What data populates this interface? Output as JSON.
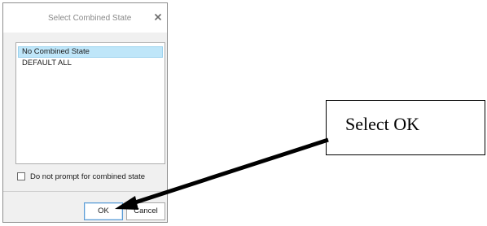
{
  "dialog": {
    "title": "Select Combined State",
    "close_glyph": "×",
    "items": [
      {
        "label": "No Combined State",
        "selected": true
      },
      {
        "label": "DEFAULT ALL",
        "selected": false
      }
    ],
    "checkbox": {
      "label": "Do not prompt for combined state",
      "checked": false
    },
    "ok_label": "OK",
    "cancel_label": "Cancel"
  },
  "callout": {
    "text": "Select OK"
  },
  "colors": {
    "dialog_bg": "#f0f0f0",
    "selection_bg": "#bfe6f9",
    "ok_border": "#5a9bd5",
    "annotation": "#000000"
  },
  "icons": {
    "close": "close-icon",
    "arrow": "pointer-arrow-icon"
  }
}
